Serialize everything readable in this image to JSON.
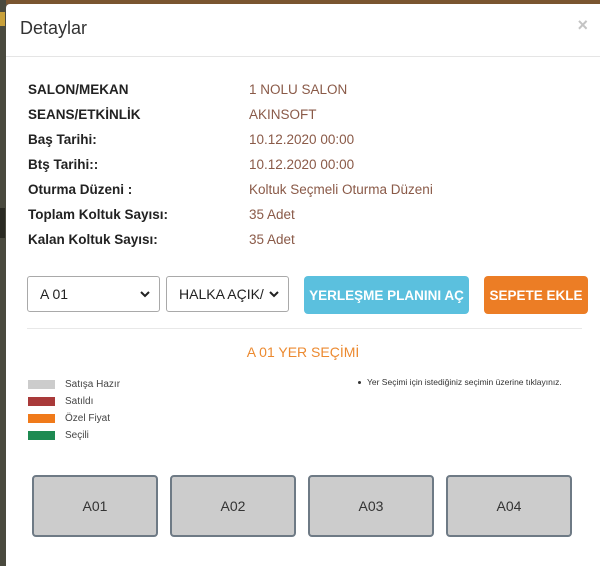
{
  "modal": {
    "title": "Detaylar",
    "close_glyph": "×"
  },
  "details": [
    {
      "label": "SALON/MEKAN",
      "value": "1 NOLU SALON"
    },
    {
      "label": "SEANS/ETKİNLİK",
      "value": "AKINSOFT"
    },
    {
      "label": "Baş Tarihi:",
      "value": "10.12.2020 00:00"
    },
    {
      "label": "Btş Tarihi::",
      "value": "10.12.2020 00:00"
    },
    {
      "label": "Oturma Düzeni :",
      "value": "Koltuk Seçmeli Oturma Düzeni"
    },
    {
      "label": "Toplam Koltuk Sayısı:",
      "value": "35 Adet"
    },
    {
      "label": "Kalan Koltuk Sayısı:",
      "value": "35 Adet"
    }
  ],
  "controls": {
    "seat_select": "A 01",
    "section_select": "HALKA AÇIK/",
    "plan_button": "YERLEŞME PLANINI AÇ",
    "cart_button": "SEPETE EKLE"
  },
  "selection_title": "A 01 YER SEÇİMİ",
  "legend": [
    {
      "label": "Satışa Hazır",
      "color": "#cccccc"
    },
    {
      "label": "Satıldı",
      "color": "#a93a3a"
    },
    {
      "label": "Özel Fiyat",
      "color": "#f07a1a"
    },
    {
      "label": "Seçili",
      "color": "#1e8a52"
    }
  ],
  "hint": "Yer Seçimi için istediğiniz seçimin üzerine tıklayınız.",
  "seats": [
    "A01",
    "A02",
    "A03",
    "A04"
  ],
  "colors": {
    "accent_orange": "#ec7d25",
    "accent_blue": "#5bc0de",
    "value_text": "#8a5a48"
  }
}
